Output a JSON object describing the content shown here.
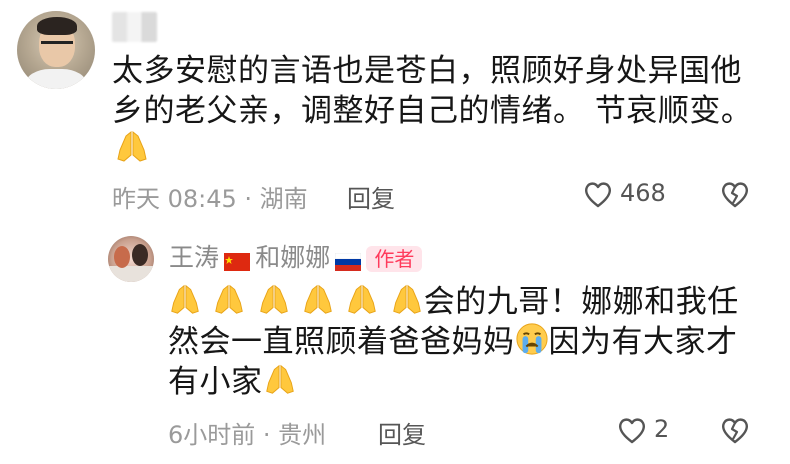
{
  "top_comment": {
    "lines": [
      "太多安慰的言语也是苍白，照顾好身处异国他",
      "乡的老父亲，调整好自己的情绪。 节哀顺变。"
    ],
    "emoji": "🙏",
    "time_location": "昨天 08:45 · 湖南",
    "reply_label": "回复",
    "likes": "468"
  },
  "reply_comment": {
    "author_part1": "王涛",
    "connector": "和娜娜",
    "author_badge": "作者",
    "line1_text": "会的九哥！娜娜和我任",
    "line2_text_a": "然会一直照顾着爸爸妈妈",
    "line2_text_b": "因为有大家才",
    "line3_text": "有小家",
    "time_location": "6小时前 · 贵州",
    "reply_label": "回复",
    "likes": "2"
  },
  "icons": {
    "like": "heart-outline-icon",
    "dislike": "broken-heart-icon",
    "pray": "folded-hands-emoji",
    "cry": "crying-face-emoji",
    "flag_china": "china-flag-icon",
    "flag_russia": "russia-flag-icon"
  },
  "colors": {
    "text": "#161616",
    "meta": "#9a9a9a",
    "author_badge_text": "#ff3b5c",
    "author_badge_bg": "#ffe4ea"
  }
}
